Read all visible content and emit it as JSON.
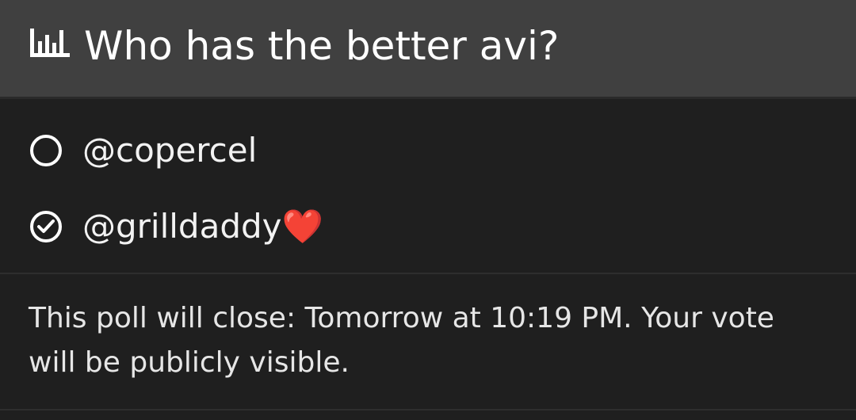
{
  "poll": {
    "title": "Who has the better avi?",
    "options": [
      {
        "label": "@copercel",
        "selected": false
      },
      {
        "label": "@grilldaddy❤️",
        "selected": true
      }
    ],
    "footer_text": "This poll will close: Tomorrow at 10:19 PM. Your vote will be publicly visible."
  },
  "icons": {
    "header": "poll-chart-icon",
    "unselected": "radio-empty-icon",
    "selected": "radio-check-icon"
  },
  "colors": {
    "header_bg": "#404040",
    "body_bg": "#1f1f1f",
    "text": "#ffffff"
  }
}
